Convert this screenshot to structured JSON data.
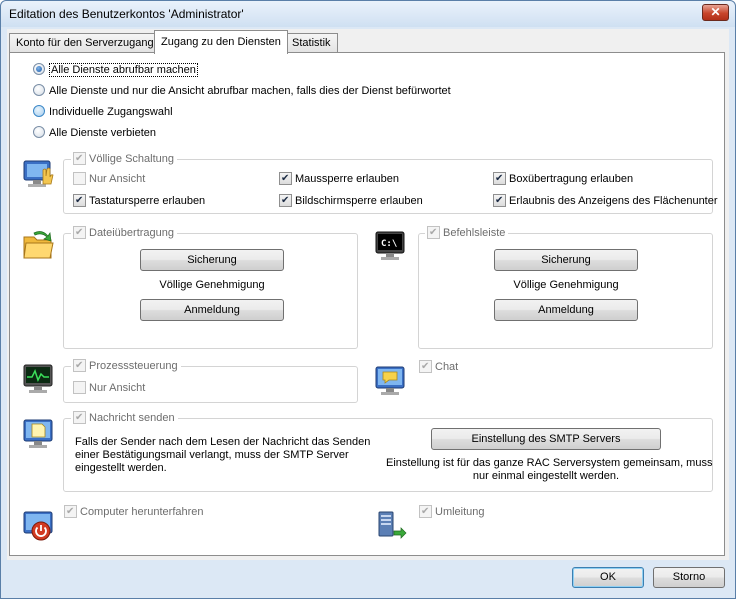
{
  "window": {
    "title": "Editation des Benutzerkontos 'Administrator'",
    "close_symbol": "✕"
  },
  "tabs": [
    {
      "label": "Konto für den Serverzugang"
    },
    {
      "label": "Zugang zu den Diensten"
    },
    {
      "label": "Statistik"
    }
  ],
  "access_options": [
    {
      "label": "Alle Dienste abrufbar machen",
      "checked": true
    },
    {
      "label": "Alle Dienste und nur die Ansicht abrufbar machen, falls dies der Dienst befürwortet",
      "checked": false
    },
    {
      "label": "Individuelle Zugangswahl",
      "checked": false
    },
    {
      "label": "Alle Dienste verbieten",
      "checked": false
    }
  ],
  "full_control": {
    "legend": "Völlige Schaltung",
    "options": [
      {
        "label": "Nur Ansicht",
        "checked": false
      },
      {
        "label": "Maussperre erlauben",
        "checked": true
      },
      {
        "label": "Boxübertragung erlauben",
        "checked": true
      },
      {
        "label": "Tastatursperre erlauben",
        "checked": true
      },
      {
        "label": "Bildschirmsperre erlauben",
        "checked": true
      },
      {
        "label": "Erlaubnis des Anzeigens des Flächenunter",
        "checked": true
      }
    ]
  },
  "file_transfer": {
    "legend": "Dateiübertragung",
    "security_button": "Sicherung",
    "permission_text": "Völlige Genehmigung",
    "login_button": "Anmeldung"
  },
  "command_line": {
    "legend": "Befehlsleiste",
    "security_button": "Sicherung",
    "permission_text": "Völlige Genehmigung",
    "login_button": "Anmeldung"
  },
  "process_control": {
    "legend": "Prozesssteuerung",
    "view_only_label": "Nur Ansicht"
  },
  "chat": {
    "label": "Chat"
  },
  "send_message": {
    "legend": "Nachricht senden",
    "description_lines": [
      "Falls der Sender nach dem Lesen der Nachricht das Senden",
      "einer Bestätigungsmail verlangt, muss der SMTP Server",
      "eingestellt werden."
    ],
    "smtp_button": "Einstellung des SMTP Servers",
    "smtp_note_lines": [
      "Einstellung ist für das ganze RAC Serversystem gemeinsam, muss",
      "nur einmal eingestellt werden."
    ]
  },
  "shutdown": {
    "label": "Computer herunterfahren"
  },
  "redirect": {
    "label": "Umleitung"
  },
  "footer": {
    "ok_button": "OK",
    "cancel_button": "Storno"
  }
}
